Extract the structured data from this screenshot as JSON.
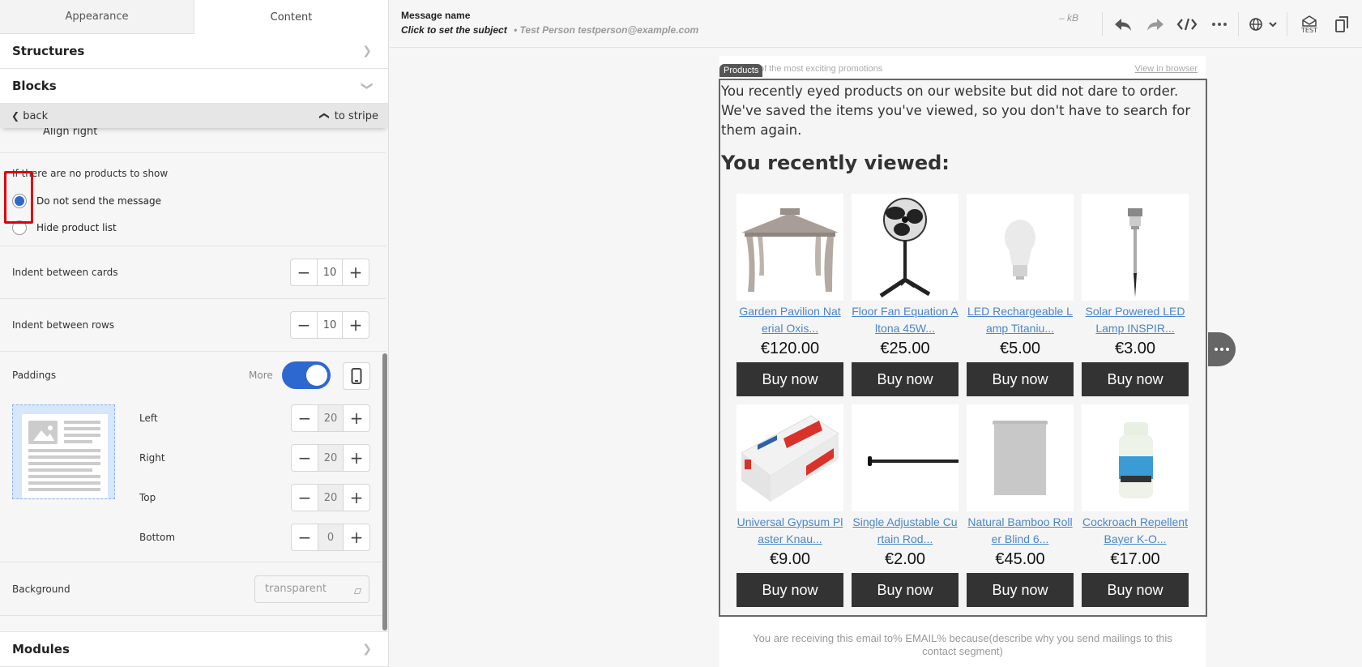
{
  "left_panel": {
    "tabs": [
      {
        "label": "Appearance",
        "active": false
      },
      {
        "label": "Content",
        "active": true
      }
    ],
    "sections": {
      "structures": "Structures",
      "blocks": "Blocks",
      "modules": "Modules"
    },
    "backbar": {
      "back": "back",
      "to_stripe": "to stripe"
    },
    "align_option": "Align right",
    "no_products": {
      "label": "If there are no products to show",
      "options": [
        {
          "label": "Do not send the message",
          "checked": true
        },
        {
          "label": "Hide product list",
          "checked": false
        }
      ]
    },
    "indent_cards": {
      "label": "Indent between cards",
      "value": "10"
    },
    "indent_rows": {
      "label": "Indent between rows",
      "value": "10"
    },
    "paddings": {
      "label": "Paddings",
      "more_label": "More",
      "more_enabled": true,
      "left": {
        "label": "Left",
        "value": "20"
      },
      "right": {
        "label": "Right",
        "value": "20"
      },
      "top": {
        "label": "Top",
        "value": "20"
      },
      "bottom": {
        "label": "Bottom",
        "value": "0"
      }
    },
    "background": {
      "label": "Background",
      "placeholder": "transparent"
    }
  },
  "topbar": {
    "message_name": "Message name",
    "subject": "Click to set the subject",
    "sender": "• Test Person testperson@example.com",
    "size": "– kB",
    "test_label": "TEST",
    "icons": [
      "undo-icon",
      "redo-icon",
      "code-icon",
      "more-icon",
      "globe-icon",
      "chevron-down-icon",
      "test-email-icon",
      "copy-icon"
    ]
  },
  "email": {
    "preheader": "der of the most exciting promotions",
    "view_in_browser": "View in browser",
    "block_tag": "Products",
    "intro": "You recently eyed products on our website but did not dare to order. We've saved the items you've viewed, so you don't have to search for them again.",
    "heading": "You recently viewed:",
    "buy_label": "Buy now",
    "products": [
      {
        "name": "Garden Pavilion Nat erial Oxis...",
        "price": "€120.00"
      },
      {
        "name": "Floor Fan Equation A ltona 45W...",
        "price": "€25.00"
      },
      {
        "name": "LED Rechargeable L amp Titaniu...",
        "price": "€5.00"
      },
      {
        "name": "Solar Powered LED Lamp INSPIR...",
        "price": "€3.00"
      },
      {
        "name": "Universal Gypsum Pl aster Knau...",
        "price": "€9.00"
      },
      {
        "name": "Single Adjustable Cu rtain Rod...",
        "price": "€2.00"
      },
      {
        "name": "Natural Bamboo Roll er Blind 6...",
        "price": "€45.00"
      },
      {
        "name": "Cockroach Repellent Bayer K-O...",
        "price": "€17.00"
      }
    ],
    "footer": "You are receiving this email to% EMAIL% because(describe why you send mailings to this contact segment)"
  },
  "colors": {
    "accent": "#2d68d0",
    "highlight": "#e0000a",
    "button_dark": "#333333",
    "link": "#4a86c8"
  }
}
